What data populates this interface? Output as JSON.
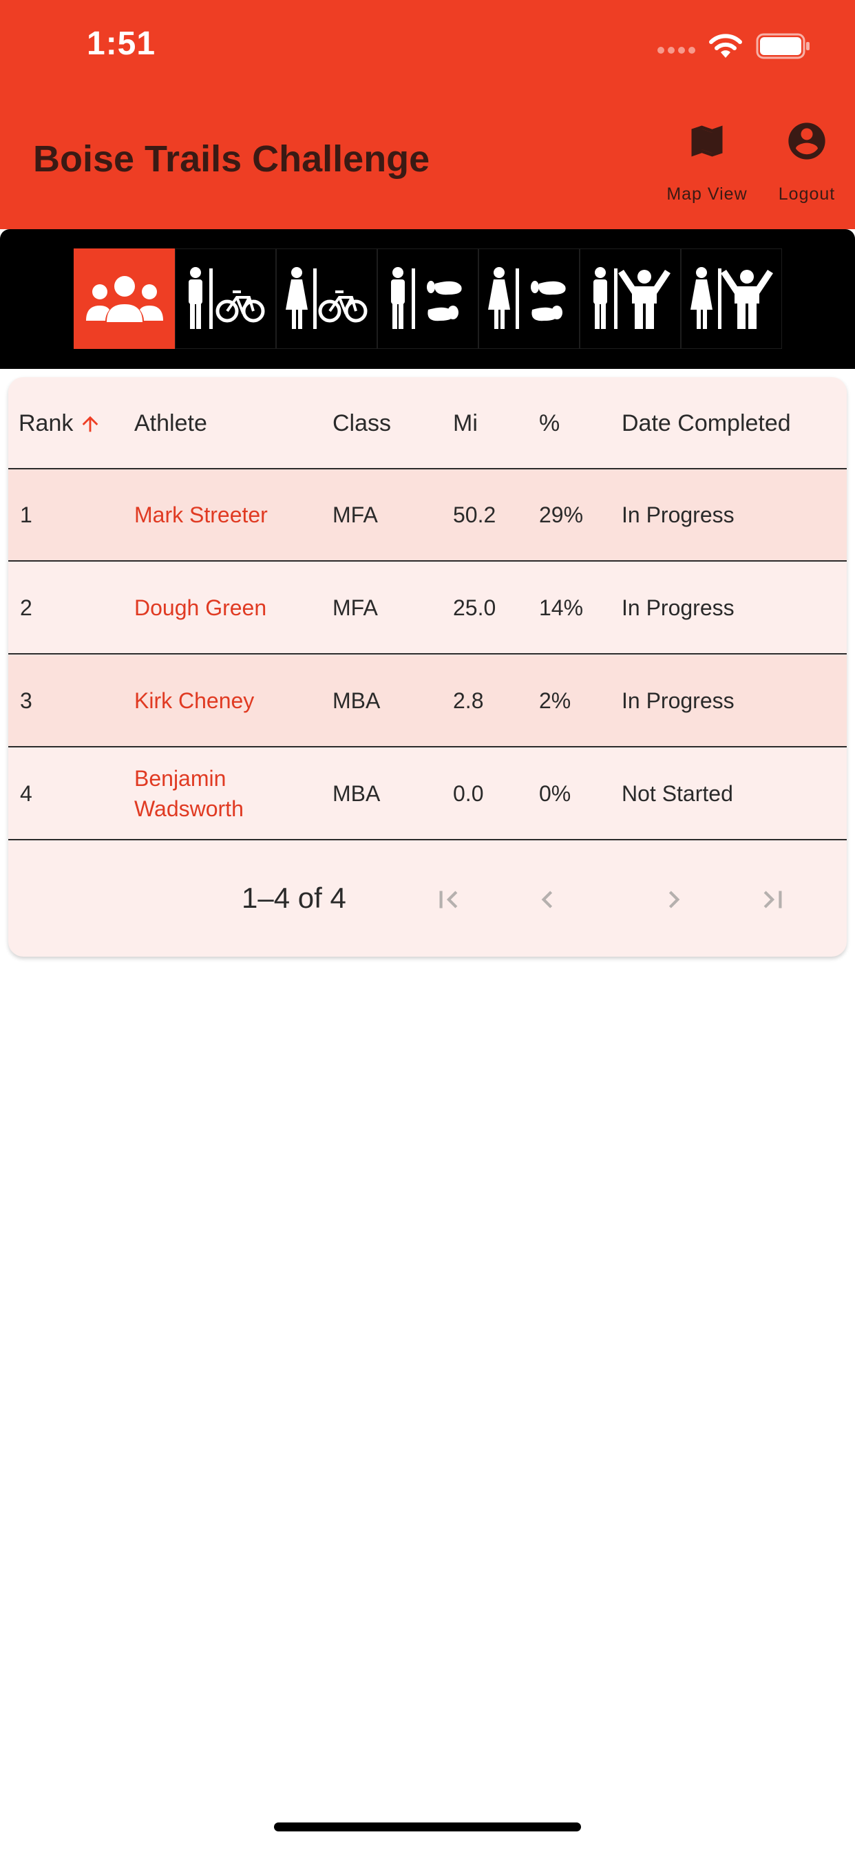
{
  "status_bar": {
    "time": "1:51"
  },
  "header": {
    "title": "Boise Trails Challenge",
    "actions": [
      {
        "label": "Map View",
        "icon": "map-icon"
      },
      {
        "label": "Logout",
        "icon": "account-circle-icon"
      }
    ]
  },
  "filters": [
    {
      "icon": "group-icon",
      "selected": true
    },
    {
      "icon": "male-bike-icon",
      "selected": false
    },
    {
      "icon": "female-bike-icon",
      "selected": false
    },
    {
      "icon": "male-foot-icon",
      "selected": false
    },
    {
      "icon": "female-foot-icon",
      "selected": false
    },
    {
      "icon": "male-kids-icon",
      "selected": false
    },
    {
      "icon": "female-kids-icon",
      "selected": false
    }
  ],
  "table": {
    "columns": [
      "Rank",
      "Athlete",
      "Class",
      "Mi",
      "%",
      "Date Completed"
    ],
    "sort": {
      "column": "Rank",
      "direction": "ascending"
    },
    "rows": [
      {
        "rank": "1",
        "athlete": "Mark Streeter",
        "class": "MFA",
        "mi": "50.2",
        "pct": "29%",
        "date": "In Progress"
      },
      {
        "rank": "2",
        "athlete": "Dough Green",
        "class": "MFA",
        "mi": "25.0",
        "pct": "14%",
        "date": "In Progress"
      },
      {
        "rank": "3",
        "athlete": "Kirk Cheney",
        "class": "MBA",
        "mi": "2.8",
        "pct": "2%",
        "date": "In Progress"
      },
      {
        "rank": "4",
        "athlete": "Benjamin Wadsworth",
        "class": "MBA",
        "mi": "0.0",
        "pct": "0%",
        "date": "Not Started"
      }
    ]
  },
  "pagination": {
    "range": "1–4 of 4"
  },
  "colors": {
    "accent": "#ee3e24",
    "link": "#e03a22",
    "row_alt": "#fbe1dc",
    "card": "#fdeeec"
  }
}
